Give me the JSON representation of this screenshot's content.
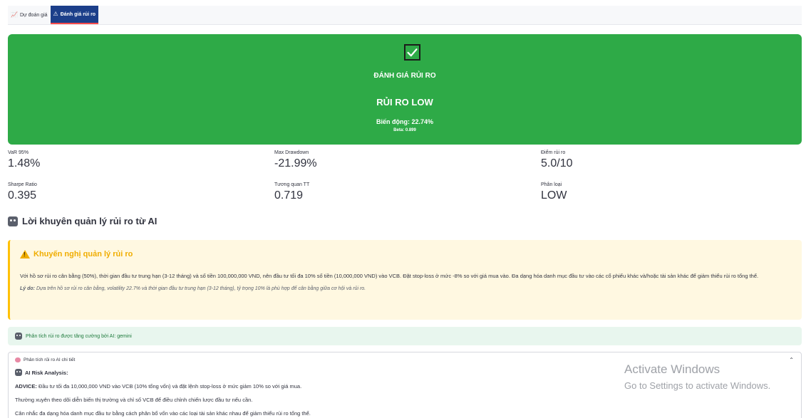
{
  "tabs": [
    {
      "icon": "chart-icon",
      "label": "Dự đoán giá",
      "active": false
    },
    {
      "icon": "warning-icon",
      "label": "Đánh giá rủi ro",
      "active": true
    }
  ],
  "risk_card": {
    "title": "ĐÁNH GIÁ RỦI RO",
    "level": "RỦI RO LOW",
    "volatility": "Biến động: 22.74%",
    "beta": "Beta: 0.899",
    "color": "#2eaa47"
  },
  "metrics": [
    {
      "label": "VaR 95%",
      "value": "1.48%"
    },
    {
      "label": "Max Drawdown",
      "value": "-21.99%"
    },
    {
      "label": "Điểm rủi ro",
      "value": "5.0/10"
    },
    {
      "label": "Sharpe Ratio",
      "value": "0.395"
    },
    {
      "label": "Tương quan TT",
      "value": "0.719"
    },
    {
      "label": "Phân loại",
      "value": "LOW"
    }
  ],
  "ai_section": {
    "title": "Lời khuyên quản lý rủi ro từ AI"
  },
  "recommendation": {
    "title": "Khuyến nghị quản lý rủi ro",
    "body": "Với hồ sơ rủi ro cân bằng (50%), thời gian đầu tư trung hạn (3-12 tháng) và số tiền 100,000,000 VND, nên đầu tư tối đa 10% số tiền (10,000,000 VND) vào VCB. Đặt stop-loss ở mức -8% so với giá mua vào. Đa dạng hóa danh mục đầu tư vào các cổ phiếu khác và/hoặc tài sản khác để giảm thiểu rủi ro tổng thể.",
    "reason_label": "Lý do:",
    "reason": "Dựa trên hồ sơ rủi ro cân bằng, volatility 22.7% và thời gian đầu tư trung hạn (3-12 tháng), tỷ trọng 10% là phù hợp để cân bằng giữa cơ hội và rủi ro."
  },
  "success_note": "Phân tích rủi ro được tăng cường bởi AI: gemini",
  "expander": {
    "header": "Phân tích rủi ro AI chi tiết",
    "subtitle": "AI Risk Analysis:",
    "advice_label": "ADVICE:",
    "advice": "Đầu tư tối đa 10,000,000 VND vào VCB (10% tổng vốn) và đặt lệnh stop-loss ở mức giảm 10% so với giá mua.",
    "line2": "Thường xuyên theo dõi diễn biến thị trường và chỉ số VCB để điều chỉnh chiến lược đầu tư nếu cần.",
    "line3": "Cân nhắc đa dạng hóa danh mục đầu tư bằng cách phân bổ vốn vào các loại tài sản khác nhau để giảm thiểu rủi ro tổng thể."
  },
  "watermark": {
    "line1": "Activate Windows",
    "line2": "Go to Settings to activate Windows."
  }
}
